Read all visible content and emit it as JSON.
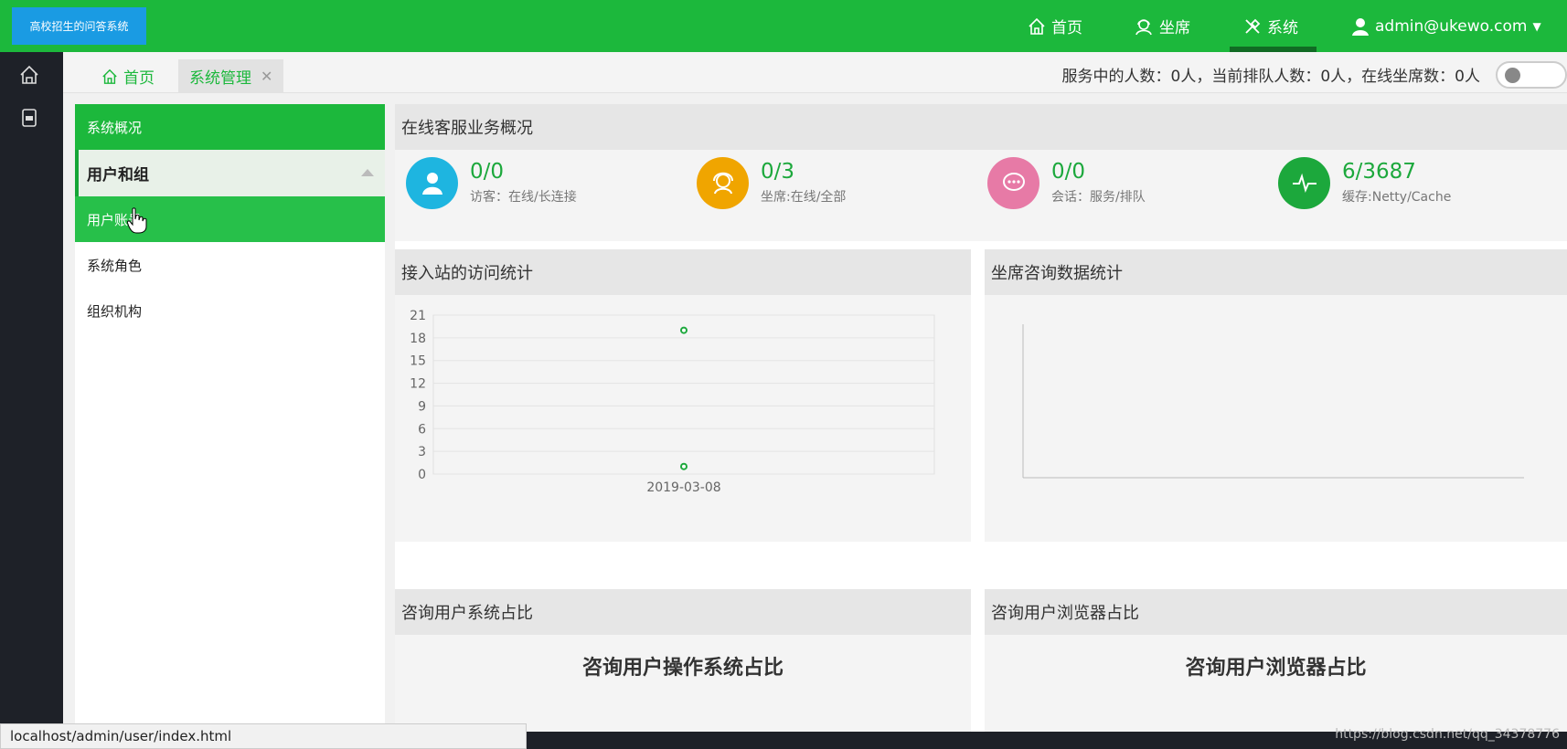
{
  "app": {
    "logo_text": "高校招生的问答系统"
  },
  "topnav": {
    "items": [
      {
        "label": "首页",
        "icon": "home-icon"
      },
      {
        "label": "坐席",
        "icon": "agent-icon"
      },
      {
        "label": "系统",
        "icon": "tools-icon",
        "active": true
      }
    ],
    "user": "admin@ukewo.com"
  },
  "tabs": [
    {
      "label": "首页",
      "icon": "home-icon"
    },
    {
      "label": "系统管理",
      "closable": true,
      "active": true
    }
  ],
  "status": {
    "text": "服务中的人数：0人，当前排队人数：0人，在线坐席数：0人"
  },
  "sidebar": {
    "header": "系统概况",
    "group": "用户和组",
    "items": [
      {
        "label": "用户账号",
        "active": true
      },
      {
        "label": "系统角色"
      },
      {
        "label": "组织机构"
      }
    ]
  },
  "overview": {
    "title": "在线客服业务概况",
    "stats": [
      {
        "value": "0/0",
        "label": "访客：在线/长连接",
        "color": "#1eb5e0",
        "icon": "user-icon"
      },
      {
        "value": "0/3",
        "label": "坐席:在线/全部",
        "color": "#f0a500",
        "icon": "headset-icon"
      },
      {
        "value": "0/0",
        "label": "会话：服务/排队",
        "color": "#e77aa6",
        "icon": "chat-icon"
      },
      {
        "value": "6/3687",
        "label": "缓存:Netty/Cache",
        "color": "#1ca83c",
        "icon": "pulse-icon"
      }
    ]
  },
  "panels": {
    "visit_stats": "接入站的访问统计",
    "agent_stats": "坐席咨询数据统计",
    "os_share": "咨询用户系统占比",
    "os_share_chart_title": "咨询用户操作系统占比",
    "browser_share": "咨询用户浏览器占比",
    "browser_share_chart_title": "咨询用户浏览器占比"
  },
  "chart_data": {
    "type": "scatter",
    "categories": [
      "2019-03-08"
    ],
    "series": [
      {
        "values": [
          19
        ]
      },
      {
        "values": [
          1
        ]
      }
    ],
    "y_ticks": [
      0,
      3,
      6,
      9,
      12,
      15,
      18,
      21
    ],
    "ylim": [
      0,
      21
    ],
    "colors": [
      "#1ca83c",
      "#1ca83c"
    ]
  },
  "browser": {
    "status_url": "localhost/admin/user/index.html",
    "watermark": "https://blog.csdn.net/qq_34378776"
  }
}
